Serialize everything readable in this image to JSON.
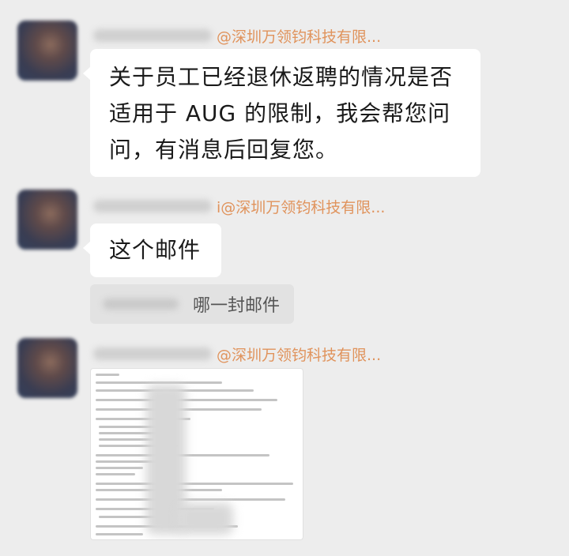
{
  "messages": [
    {
      "sender_suffix": "@深圳万领钧科技有限...",
      "text_lines": [
        "关于员工已经退休返聘的情况是否",
        "适用于 AUG 的限制，我会帮您问",
        "问，有消息后回复您。"
      ]
    },
    {
      "sender_suffix": "i@深圳万领钧科技有限...",
      "text_lines": [
        "这个邮件"
      ]
    },
    {
      "sender_suffix": "@深圳万领钧科技有限..."
    }
  ],
  "quote": {
    "text": "哪一封邮件"
  },
  "colors": {
    "background": "#ededed",
    "bubble": "#ffffff",
    "sender": "#e0935c",
    "quote_bg": "#e2e2e2"
  },
  "icons": {
    "avatar": "avatar-icon"
  }
}
